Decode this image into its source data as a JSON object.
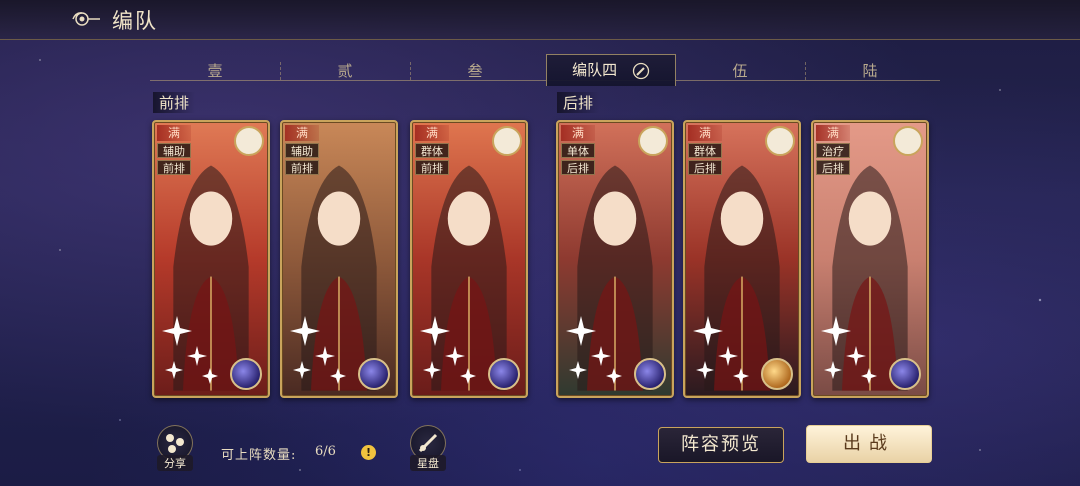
{
  "header": {
    "title": "编队",
    "back_icon": "cloud-scroll-back-icon"
  },
  "tabs": [
    {
      "label": "壹",
      "active": false
    },
    {
      "label": "贰",
      "active": false
    },
    {
      "label": "叁",
      "active": false
    },
    {
      "label": "编队四",
      "active": true,
      "icon": "edit-pencil-icon"
    },
    {
      "label": "伍",
      "active": false
    },
    {
      "label": "陆",
      "active": false
    }
  ],
  "rows": {
    "front": "前排",
    "back": "后排"
  },
  "cards": [
    {
      "full": "满",
      "role": "辅助",
      "position": "前排",
      "element_icon": "red-bird-icon",
      "skill_icon": "purple-swirl-orb-icon"
    },
    {
      "full": "满",
      "role": "辅助",
      "position": "前排",
      "element_icon": "",
      "skill_icon": "purple-moon-orb-icon"
    },
    {
      "full": "满",
      "role": "群体",
      "position": "前排",
      "element_icon": "teal-dragon-icon",
      "skill_icon": "purple-moon-orb-icon"
    },
    {
      "full": "满",
      "role": "单体",
      "position": "后排",
      "element_icon": "blue-dragon-icon",
      "skill_icon": "purple-moon-orb-icon"
    },
    {
      "full": "满",
      "role": "群体",
      "position": "后排",
      "element_icon": "scorpion-icon",
      "skill_icon": "gold-sun-orb-icon"
    },
    {
      "full": "满",
      "role": "治疗",
      "position": "后排",
      "element_icon": "white-bird-icon",
      "skill_icon": "purple-moon-orb-icon"
    }
  ],
  "bottom": {
    "share_label": "分享",
    "count_label": "可上阵数量:",
    "count_value": "6/6",
    "info_icon": "!",
    "star_label": "星盘",
    "preview_label": "阵容预览",
    "fight_label": "出战"
  },
  "colors": {
    "accent_gold": "#c9a45c",
    "card_red": "#a8382a",
    "bg_night": "#1e1d42"
  }
}
